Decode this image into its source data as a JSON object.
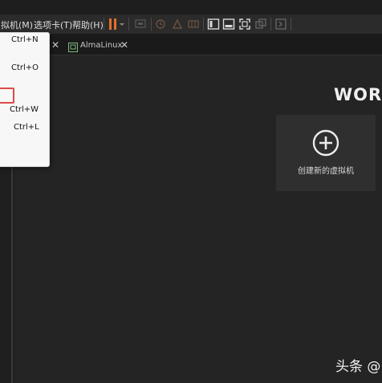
{
  "menubar": {
    "items": [
      "拟机(M)",
      "选项卡(T)",
      "帮助(H)"
    ]
  },
  "tabs": [
    {
      "label": "AlmaLinux"
    }
  ],
  "file_menu": {
    "shortcuts": [
      "Ctrl+N",
      "Ctrl+O",
      "Ctrl+W",
      "Ctrl+L"
    ]
  },
  "home": {
    "title": "WORK",
    "create_vm_label": "创建新的虚拟机"
  },
  "watermark": "头条 @",
  "colors": {
    "accent_pause": "#e0702a",
    "highlight": "#e0484a",
    "background": "#222222"
  }
}
